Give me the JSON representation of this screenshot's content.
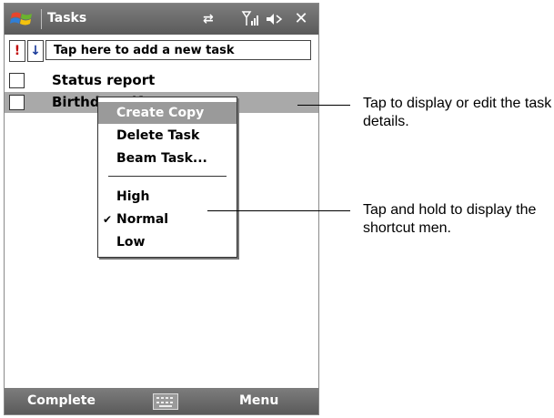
{
  "titlebar": {
    "title": "Tasks",
    "start_icon": "windows-flag-icon",
    "connectivity_icon": "connectivity-icon",
    "signal_icon": "signal-icon",
    "volume_icon": "volume-icon",
    "close_label": "✕"
  },
  "entry_bar": {
    "priority_label": "!",
    "sort_label": "↓",
    "new_task_text": "Tap here to add a new task"
  },
  "tasks": [
    {
      "label": "Status report",
      "checked": false,
      "selected": false
    },
    {
      "label": "Birthday gift",
      "checked": false,
      "selected": true
    }
  ],
  "context_menu": {
    "items": [
      "Create Copy",
      "Delete Task",
      "Beam Task...",
      "High",
      "Normal",
      "Low"
    ],
    "selected_item": "Create Copy",
    "checked_item": "Normal",
    "check_glyph": "✔"
  },
  "bottom_bar": {
    "left_label": "Complete",
    "keyboard_icon": "keyboard-icon",
    "right_label": "Menu"
  },
  "callouts": {
    "first": "Tap to display or edit the task details.",
    "second": "Tap and hold to display the shortcut men."
  }
}
